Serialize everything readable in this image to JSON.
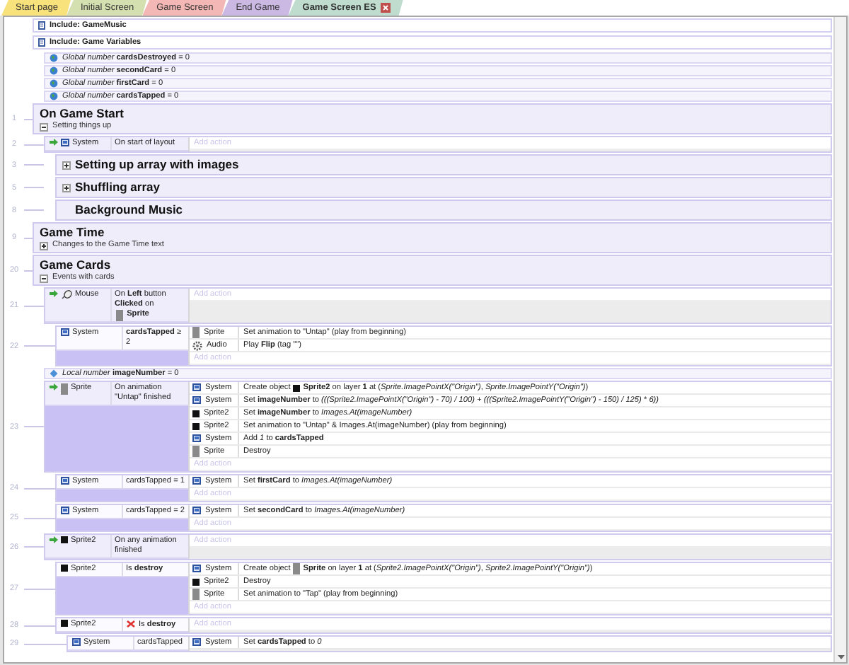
{
  "tabs": [
    {
      "label": "Start page",
      "color": "#f8e27c",
      "selected": false
    },
    {
      "label": "Initial Screen",
      "color": "#d5e0b0",
      "selected": false
    },
    {
      "label": "Game Screen",
      "color": "#f3b8b5",
      "selected": false
    },
    {
      "label": "End Game",
      "color": "#cbb9e4",
      "selected": false
    },
    {
      "label": "Game Screen ES",
      "color": "#bfdccf",
      "selected": true
    }
  ],
  "rows": [
    {
      "kind": "include",
      "text": "Include: GameMusic"
    },
    {
      "kind": "include",
      "text": "Include: Game Variables"
    },
    {
      "kind": "global",
      "text": "*Global number* **cardsDestroyed** = 0"
    },
    {
      "kind": "global",
      "text": "*Global number* **secondCard** = 0"
    },
    {
      "kind": "global",
      "text": "*Global number* **firstCard** = 0"
    },
    {
      "kind": "global",
      "text": "*Global number* **cardsTapped** = 0"
    },
    {
      "kind": "group",
      "number": "1",
      "title": "On Game Start",
      "description": "Setting things up",
      "expanded": true,
      "children": [
        {
          "kind": "event",
          "number": "2",
          "trigger": true,
          "conditions": [
            {
              "object": "System",
              "kind": "system",
              "inverted": false,
              "text": "On start of layout"
            }
          ],
          "add_action": "Add action"
        },
        {
          "kind": "group",
          "number": "3",
          "title": "Setting up array with images",
          "expanded": false
        },
        {
          "kind": "group",
          "number": "5",
          "title": "Shuffling array",
          "expanded": false
        },
        {
          "kind": "group",
          "number": "8",
          "title": "Background Music"
        }
      ]
    },
    {
      "kind": "group",
      "number": "9",
      "title": "Game Time",
      "description": "Changes to the Game Time text",
      "expanded": false
    },
    {
      "kind": "group",
      "number": "20",
      "title": "Game Cards",
      "description": "Events with cards",
      "expanded": true,
      "children": [
        {
          "kind": "event",
          "number": "21",
          "trigger": true,
          "conditions": [
            {
              "object": "Mouse",
              "kind": "mouse",
              "inverted": false,
              "text": "On **Left** button **Clicked** on",
              "param": {
                "kind": "sprite",
                "text": "**Sprite**"
              }
            }
          ],
          "add_action": "Add action",
          "children": [
            {
              "kind": "event",
              "number": "22",
              "trigger": false,
              "conditions": [
                {
                  "object": "System",
                  "kind": "system",
                  "inverted": false,
                  "text": "**cardsTapped** ≥ 2"
                }
              ],
              "actions": [
                {
                  "object": "Sprite",
                  "kind": "sprite",
                  "text": "Set animation to \"Untap\" (play from beginning)"
                },
                {
                  "object": "Audio",
                  "kind": "audio",
                  "text": "Play **Flip** (tag \"\")"
                }
              ],
              "add_action": "Add action"
            }
          ]
        },
        {
          "kind": "local",
          "text": "*Local number* **imageNumber** = 0"
        },
        {
          "kind": "event",
          "number": "23",
          "trigger": true,
          "conditions": [
            {
              "object": "Sprite",
              "kind": "sprite",
              "inverted": false,
              "text": "On animation \"Untap\" finished"
            }
          ],
          "actions": [
            {
              "object": "System",
              "kind": "system",
              "text": "Create object",
              "param": {
                "kind": "sprite2",
                "text": "**Sprite2** on layer **1** at (*Sprite.ImagePointX(\"Origin\")*, *Sprite.ImagePointY(\"Origin\")*)"
              }
            },
            {
              "object": "System",
              "kind": "system",
              "text": "Set **imageNumber** to *(((Sprite2.ImagePointX(\"Origin\") - 70) / 100) + (((Sprite2.ImagePointY(\"Origin\") - 150) / 125)* * *6))*"
            },
            {
              "object": "Sprite2",
              "kind": "sprite2",
              "text": "Set **imageNumber** to *Images.At(imageNumber)*"
            },
            {
              "object": "Sprite2",
              "kind": "sprite2",
              "text": "Set animation to \"Untap\" & Images.At(imageNumber) (play from beginning)"
            },
            {
              "object": "System",
              "kind": "system",
              "text": "Add *1* to **cardsTapped**"
            },
            {
              "object": "Sprite",
              "kind": "sprite",
              "text": "Destroy"
            }
          ],
          "add_action": "Add action",
          "children": [
            {
              "kind": "event",
              "number": "24",
              "trigger": false,
              "conditions": [
                {
                  "object": "System",
                  "kind": "system",
                  "inverted": false,
                  "text": "cardsTapped = 1"
                }
              ],
              "actions": [
                {
                  "object": "System",
                  "kind": "system",
                  "text": "Set **firstCard** to *Images.At(imageNumber)*"
                }
              ],
              "add_action": "Add action"
            },
            {
              "kind": "event",
              "number": "25",
              "trigger": false,
              "conditions": [
                {
                  "object": "System",
                  "kind": "system",
                  "inverted": false,
                  "text": "cardsTapped = 2"
                }
              ],
              "actions": [
                {
                  "object": "System",
                  "kind": "system",
                  "text": "Set **secondCard** to *Images.At(imageNumber)*"
                }
              ],
              "add_action": "Add action"
            }
          ]
        },
        {
          "kind": "event",
          "number": "26",
          "trigger": true,
          "conditions": [
            {
              "object": "Sprite2",
              "kind": "sprite2",
              "inverted": false,
              "text": "On any animation finished"
            }
          ],
          "add_action": "Add action",
          "children": [
            {
              "kind": "event",
              "number": "27",
              "trigger": false,
              "conditions": [
                {
                  "object": "Sprite2",
                  "kind": "sprite2",
                  "inverted": false,
                  "text": "Is **destroy**"
                }
              ],
              "actions": [
                {
                  "object": "System",
                  "kind": "system",
                  "text": "Create object",
                  "param": {
                    "kind": "sprite",
                    "text": "**Sprite** on layer **1** at (*Sprite2.ImagePointX(\"Origin\")*, *Sprite2.ImagePointY(\"Origin\")*)"
                  }
                },
                {
                  "object": "Sprite2",
                  "kind": "sprite2",
                  "text": "Destroy"
                },
                {
                  "object": "Sprite",
                  "kind": "sprite",
                  "text": "Set animation to \"Tap\" (play from beginning)"
                }
              ],
              "add_action": "Add action"
            },
            {
              "kind": "event",
              "number": "28",
              "trigger": false,
              "conditions": [
                {
                  "object": "Sprite2",
                  "kind": "sprite2",
                  "inverted": true,
                  "text": "Is **destroy**"
                }
              ],
              "add_action": "Add action",
              "children": [
                {
                  "kind": "event",
                  "number": "29",
                  "trigger": false,
                  "conditions": [
                    {
                      "object": "System",
                      "kind": "system",
                      "inverted": false,
                      "text": "cardsTapped"
                    }
                  ],
                  "actions": [
                    {
                      "object": "System",
                      "kind": "system",
                      "text": "Set **cardsTapped** to *0*"
                    }
                  ]
                }
              ]
            }
          ]
        }
      ]
    }
  ]
}
